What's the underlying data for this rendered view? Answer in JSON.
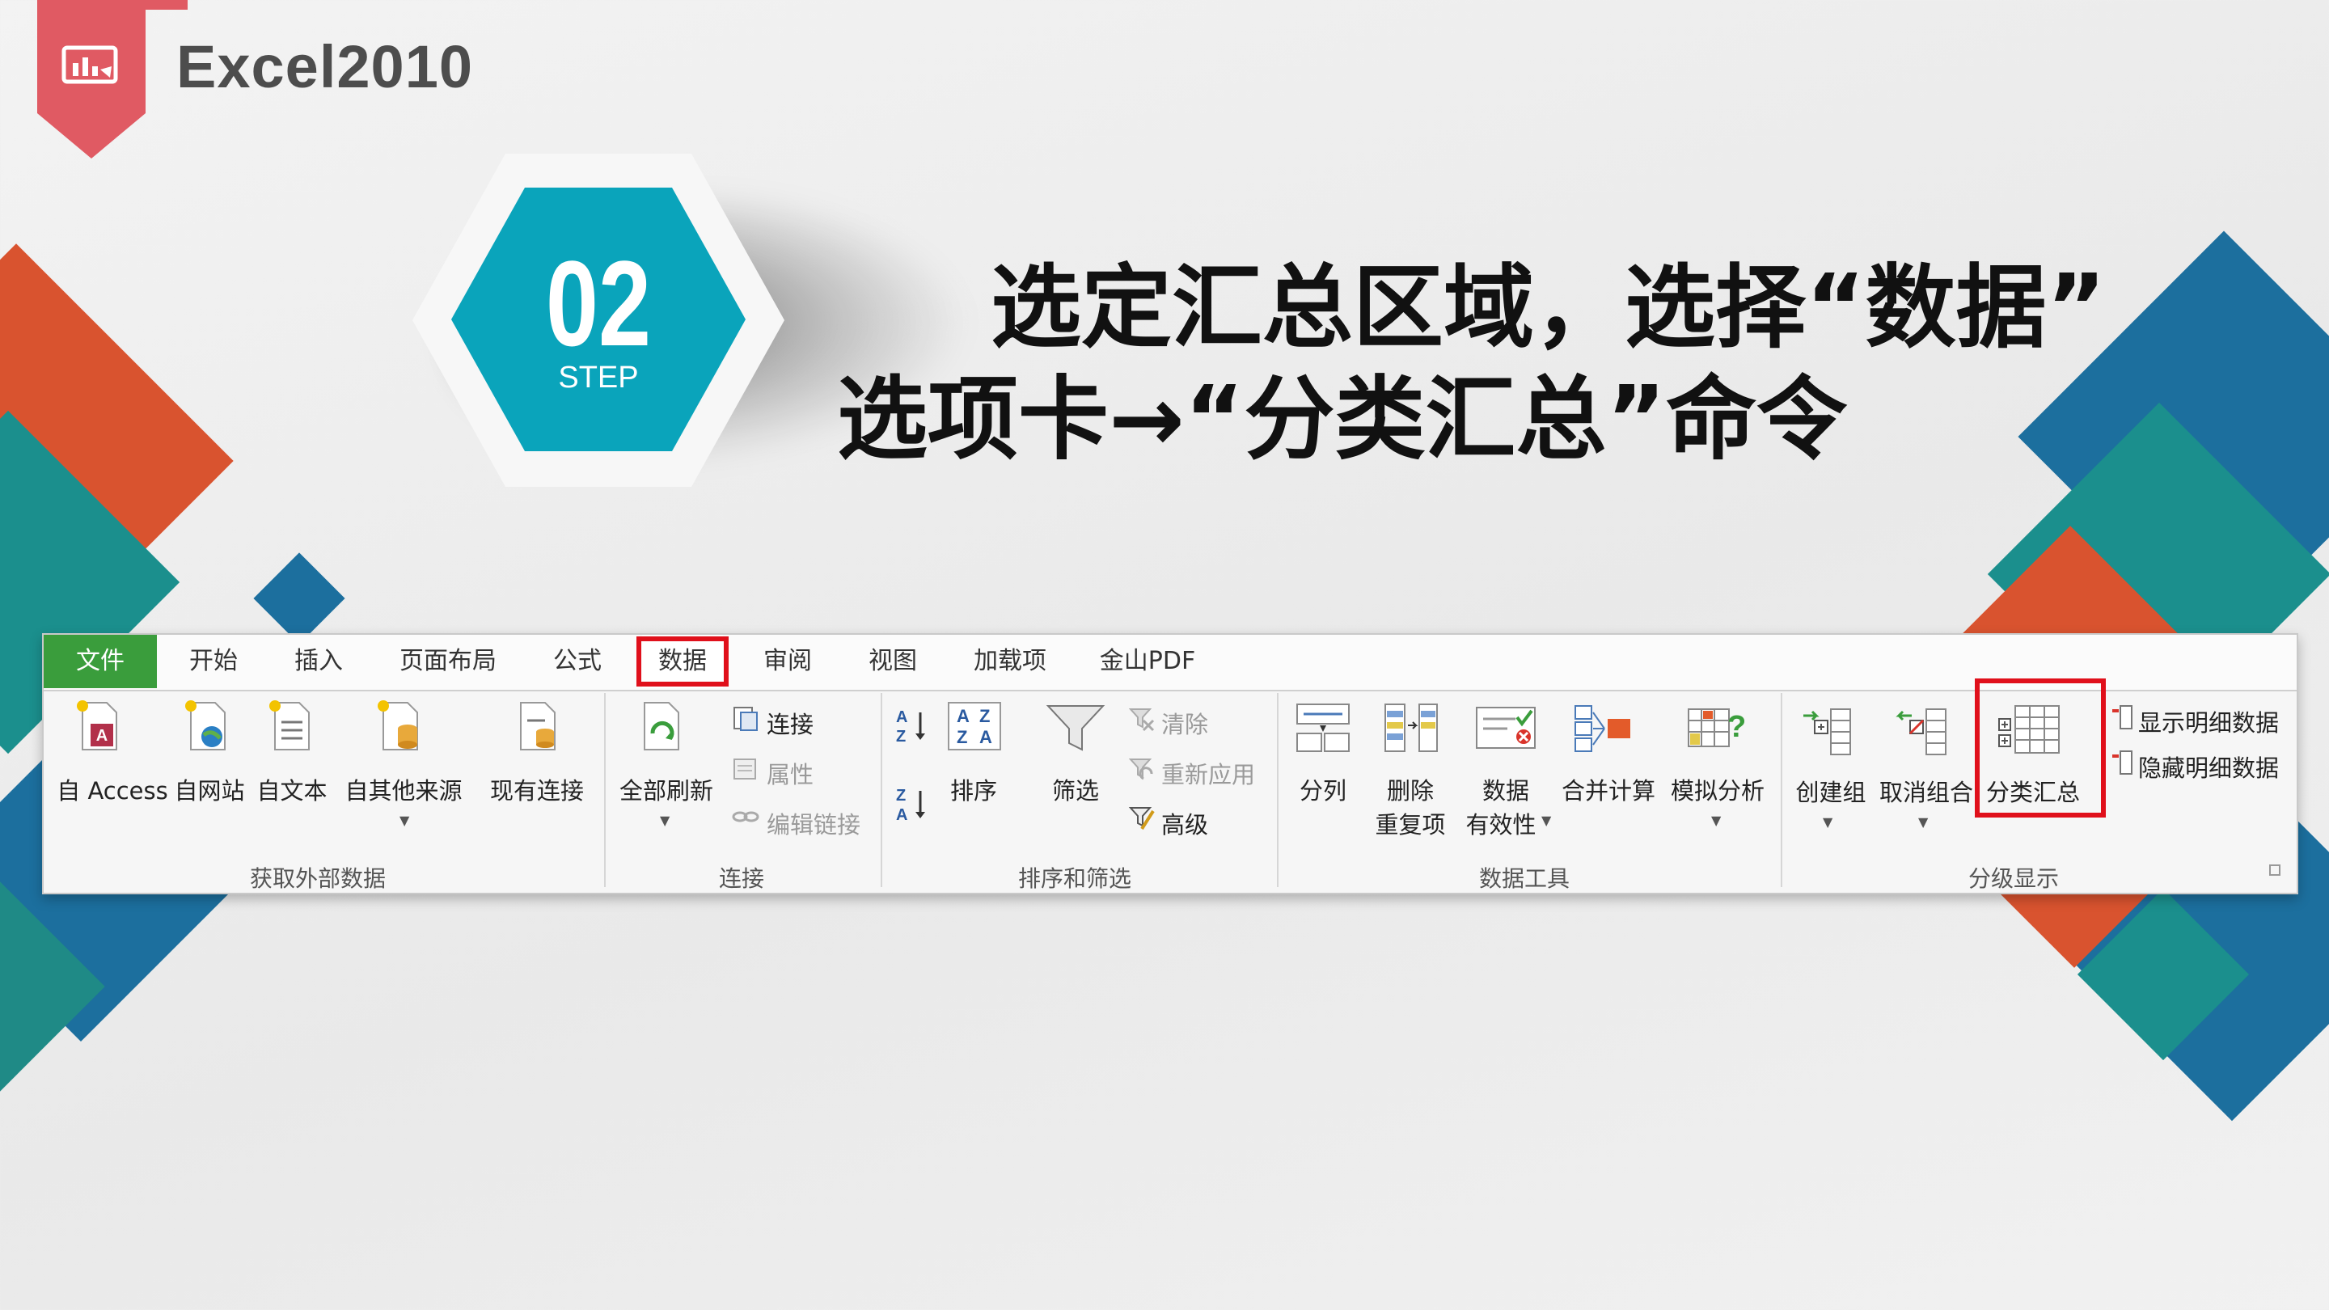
{
  "header": {
    "title": "Excel2010"
  },
  "step": {
    "number": "02",
    "label": "STEP"
  },
  "headline": {
    "line1": "选定汇总区域，选择“数据”",
    "line2": "选项卡→“分类汇总”命令"
  },
  "ribbon": {
    "tabs": [
      "文件",
      "开始",
      "插入",
      "页面布局",
      "公式",
      "数据",
      "审阅",
      "视图",
      "加载项",
      "金山PDF"
    ],
    "active_tab": "数据",
    "groups": {
      "external": {
        "name": "获取外部数据",
        "buttons": [
          "自 Access",
          "自网站",
          "自文本",
          "自其他来源",
          "现有连接"
        ]
      },
      "connections": {
        "name": "连接",
        "refresh_all": "全部刷新",
        "items": [
          "连接",
          "属性",
          "编辑链接"
        ]
      },
      "sort_filter": {
        "name": "排序和筛选",
        "sort": "排序",
        "filter": "筛选",
        "items": [
          "清除",
          "重新应用",
          "高级"
        ]
      },
      "data_tools": {
        "name": "数据工具",
        "buttons": [
          "分列",
          "删除",
          "重复项",
          "数据",
          "有效性",
          "合并计算",
          "模拟分析"
        ]
      },
      "outline": {
        "name": "分级显示",
        "buttons": [
          "创建组",
          "取消组合",
          "分类汇总"
        ],
        "items": [
          "显示明细数据",
          "隐藏明细数据"
        ]
      }
    },
    "highlight_color": "#e0101b"
  },
  "colors": {
    "accent_red": "#e05a63",
    "teal": "#0aa4bb",
    "file_tab": "#3a9d3c"
  }
}
